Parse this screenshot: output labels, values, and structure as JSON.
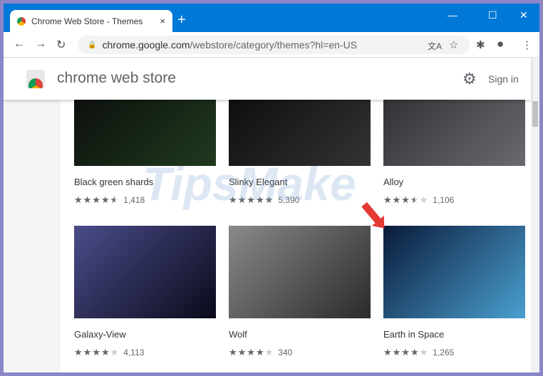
{
  "tab": {
    "title": "Chrome Web Store - Themes",
    "close": "×"
  },
  "window": {
    "new_tab": "+",
    "minimize": "—",
    "maximize": "☐",
    "close": "✕"
  },
  "toolbar": {
    "back": "←",
    "forward": "→",
    "reload": "↻",
    "url_host": "chrome.google.com",
    "url_path": "/webstore/category/themes?hl=en-US"
  },
  "header": {
    "brand": "chrome web store",
    "signin": "Sign in"
  },
  "watermark": "TipsMake",
  "themes": [
    {
      "name": "Black green shards",
      "rating": 4.5,
      "count": "1,418",
      "colors": [
        "#0b0b0b",
        "#1f3a1f"
      ]
    },
    {
      "name": "Slinky Elegant",
      "rating": 5,
      "count": "5,390",
      "colors": [
        "#0a0a0a",
        "#333333"
      ]
    },
    {
      "name": "Alloy",
      "rating": 3.5,
      "count": "1,106",
      "colors": [
        "#2a2a2e",
        "#6a6a70"
      ]
    },
    {
      "name": "Galaxy-View",
      "rating": 4,
      "count": "4,113",
      "colors": [
        "#4a4c8a",
        "#0a0a1a"
      ]
    },
    {
      "name": "Wolf",
      "rating": 4,
      "count": "340",
      "colors": [
        "#8a8a8a",
        "#2a2a2a"
      ]
    },
    {
      "name": "Earth in Space",
      "rating": 4,
      "count": "1,265",
      "colors": [
        "#0a1a3a",
        "#4aa0d0"
      ]
    }
  ]
}
